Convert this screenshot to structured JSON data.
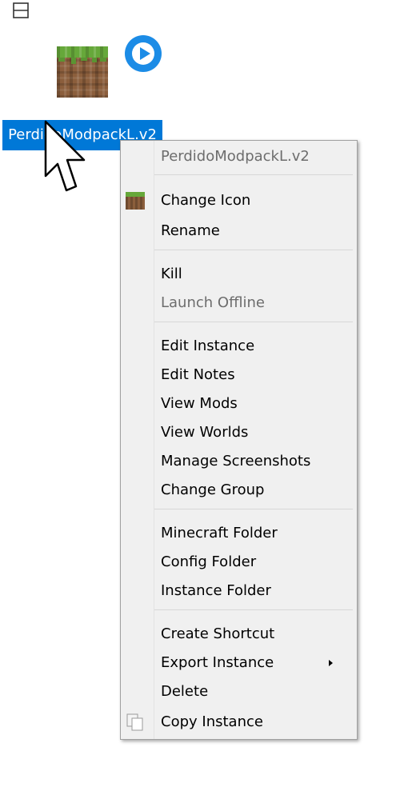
{
  "instance": {
    "name": "PerdidoModpackL.v2",
    "icon": "minecraft-grass-block-icon",
    "status_icon": "play-icon"
  },
  "colors": {
    "selection": "#0078d7",
    "play_badge": "#1c8ce6",
    "menu_bg": "#f0f0f0",
    "disabled_text": "#6d6d6d"
  },
  "menu": {
    "header": "PerdidoModpackL.v2",
    "change_icon": "Change Icon",
    "rename": "Rename",
    "kill": "Kill",
    "launch_offline": "Launch Offline",
    "edit_instance": "Edit Instance",
    "edit_notes": "Edit Notes",
    "view_mods": "View Mods",
    "view_worlds": "View Worlds",
    "manage_screenshots": "Manage Screenshots",
    "change_group": "Change Group",
    "minecraft_folder": "Minecraft Folder",
    "config_folder": "Config Folder",
    "instance_folder": "Instance Folder",
    "create_shortcut": "Create Shortcut",
    "export_instance": "Export Instance",
    "delete": "Delete",
    "copy_instance": "Copy Instance"
  }
}
